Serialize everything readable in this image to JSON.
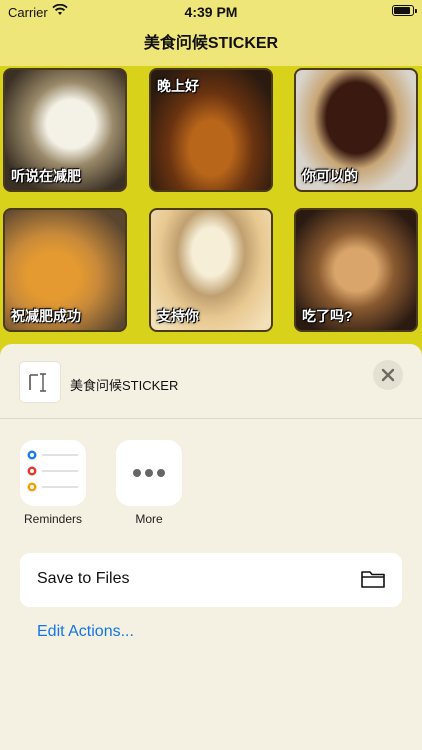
{
  "status_bar": {
    "carrier": "Carrier",
    "time": "4:39 PM",
    "battery_level": 0.9
  },
  "nav": {
    "title": "美食问候STICKER"
  },
  "stickers": [
    {
      "caption": "听说在减肥",
      "icon": "panna-cotta-photo"
    },
    {
      "caption": "晚上好",
      "icon": "grilled-chicken-photo"
    },
    {
      "caption": "你可以的",
      "icon": "chocolate-cake-photo"
    },
    {
      "caption": "祝减肥成功",
      "icon": "pastry-syrup-photo"
    },
    {
      "caption": "支持你",
      "icon": "ice-cream-cone-photo"
    },
    {
      "caption": "吃了吗?",
      "icon": "grilled-meat-photo"
    }
  ],
  "sheet": {
    "title": "美食问候STICKER",
    "doc_icon": "text-document-icon",
    "close_icon": "close-icon",
    "apps": [
      {
        "label": "Reminders",
        "icon": "reminders-icon"
      },
      {
        "label": "More",
        "icon": "more-icon"
      }
    ],
    "actions": [
      {
        "label": "Save to Files",
        "icon": "folder-icon"
      }
    ],
    "edit_actions": "Edit Actions..."
  },
  "colors": {
    "accent": "#1476e6",
    "app_background": "#d9d21a",
    "sheet_background": "#f4f0e2"
  }
}
